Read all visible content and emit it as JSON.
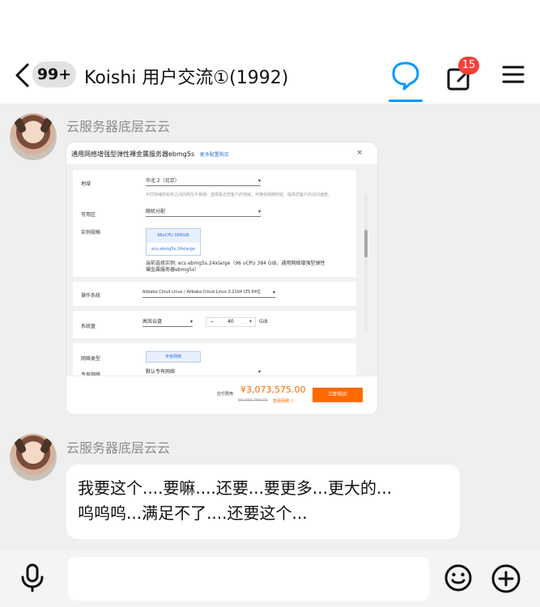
{
  "header": {
    "unread_badge": "99+",
    "chat_title": "Koishi 用户交流①(1992)",
    "notification_count": "15",
    "accent_color": "#0099ff"
  },
  "messages": [
    {
      "sender": "云服务器底层云云",
      "type": "image",
      "screenshot": {
        "title": "通用网络增强型弹性裸金属服务器ebmg5s",
        "more_link": "更多配置购买",
        "close": "×",
        "region_label": "地域",
        "region_value": "华北 2（北京）",
        "region_hint": "不同地域的实例之间内网互不相通；选择靠近您客户的地域，可降低网络时延、提高您客户的访问速度。",
        "zone_label": "可用区",
        "zone_value": "随机分配",
        "spec_label": "实例规格",
        "spec_option_top": "96vCPU 384GiB",
        "spec_option_bottom": "ecs.ebmg5s.24xlarge",
        "spec_desc": "当前选择实例: ecs.ebmg5s.24xlarge（96 vCPU 384 GiB，通用网络增强型弹性裸金属服务器ebmg5s）",
        "os_label": "操作系统",
        "os_value": "Alibaba Cloud Linux / Alibaba Cloud Linux 3.2104 LTS 64位",
        "disk_label": "系统盘",
        "disk_type": "高效云盘",
        "disk_minus": "−",
        "disk_size": "40",
        "disk_plus": "+",
        "disk_unit": "GiB",
        "net_type_label": "网络类型",
        "net_type_value": "专有网络",
        "vpc_label": "专有网络",
        "vpc_value": "默认专有网络",
        "pay_label": "应付费用",
        "price": "¥3,073,575.00",
        "original_price": "¥6,983,780.00",
        "detail_link": "查看明细 ▽",
        "buy_button": "立即购买"
      }
    },
    {
      "sender": "云服务器底层云云",
      "type": "text",
      "text_line1": "我要这个....要嘛....还要...要更多...更大的...",
      "text_line2": "呜呜呜...满足不了....还要这个..."
    }
  ],
  "input": {
    "mic_icon": "microphone-icon",
    "emoji_icon": "smiley-icon",
    "plus_icon": "plus-circle-icon"
  }
}
